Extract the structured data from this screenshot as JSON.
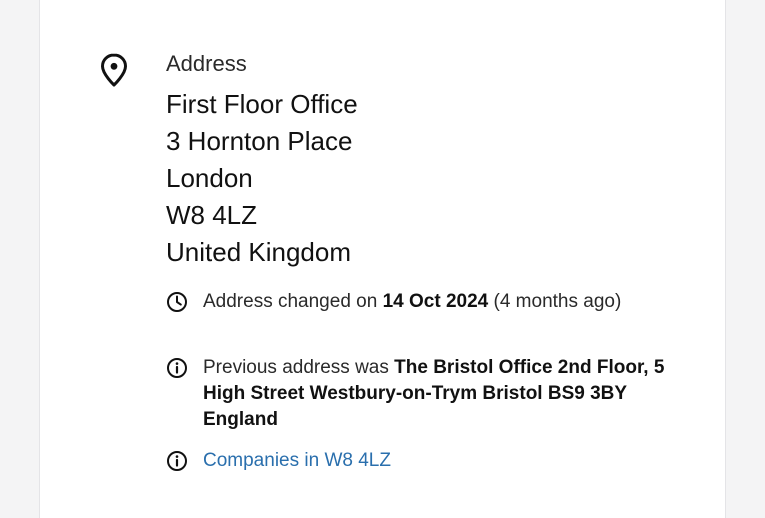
{
  "address": {
    "label": "Address",
    "lines": [
      "First Floor Office",
      "3 Hornton Place",
      "London",
      "W8 4LZ",
      "United Kingdom"
    ]
  },
  "changed": {
    "prefix": "Address changed on ",
    "date": "14 Oct 2024",
    "suffix": " (4 months ago)"
  },
  "previous": {
    "prefix": "Previous address was ",
    "address": "The Bristol Office 2nd Floor, 5 High Street Westbury-on-Trym Bristol BS9 3BY England"
  },
  "companies_link": "Companies in W8 4LZ",
  "colors": {
    "link": "#2a6fad",
    "text": "#111111",
    "muted": "#2a2a2a",
    "card": "#ffffff",
    "background": "#f4f4f5"
  }
}
